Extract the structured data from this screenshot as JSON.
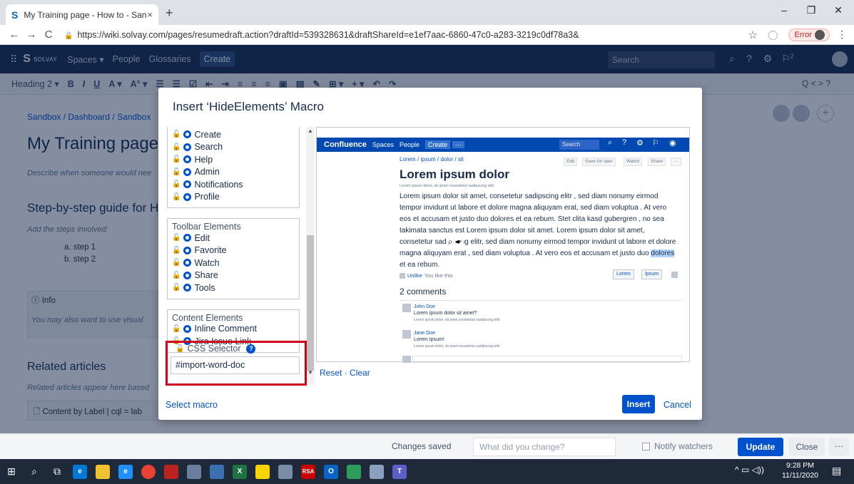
{
  "browser": {
    "tab_title": "My Training page - How to - San",
    "tab_close": "×",
    "new_tab": "+",
    "url": "https://wiki.solvay.com/pages/resumedraft.action?draftId=539328631&draftShareId=e1ef7aac-6860-47c0-a283-3219c0df78a3&",
    "error_label": "Error",
    "win_min": "–",
    "win_max": "❐",
    "win_close": "✕"
  },
  "confluence": {
    "brand": "SOLVAY",
    "menu": [
      "Spaces ▾",
      "People",
      "Glossaries"
    ],
    "create": "Create",
    "search_placeholder": "Search",
    "notif_count": "2"
  },
  "toolbar": {
    "heading": "Heading 2",
    "heading_caret": "▾",
    "buttons": [
      "B",
      "I",
      "U",
      "A ▾",
      "A° ▾",
      "☰",
      "☰",
      "☑",
      "⇤",
      "⇥",
      "≡",
      "≡",
      "≡",
      "▣",
      "▨",
      "✎",
      "⊞ ▾",
      "+ ▾",
      "↶",
      "↷"
    ],
    "right": "Q   < >   ?"
  },
  "page": {
    "breadcrumb": "Sandbox / Dashboard / Sandbox",
    "title": "My Training page",
    "description": "Describe when someone would nee",
    "step_heading": "Step-by-step guide for H",
    "add_steps": "Add the steps involved:",
    "step_a": "a. step 1",
    "step_b": "b. step 2",
    "info_label": "ⓘ  Info",
    "info_text": "You may also want to use visual",
    "related_heading": "Related articles",
    "related_sub": "Related articles appear here based",
    "content_by_label": "Content by Label | cql = lab"
  },
  "footer": {
    "changes_saved": "Changes saved",
    "what_changed_placeholder": "What did you change?",
    "notify": "Notify watchers",
    "update": "Update",
    "close": "Close",
    "more": "···"
  },
  "taskbar": {
    "time": "9:28 PM",
    "date": "11/11/2020"
  },
  "modal": {
    "title": "Insert ‘HideElements’ Macro",
    "header_items": [
      "Create",
      "Search",
      "Help",
      "Admin",
      "Notifications",
      "Profile"
    ],
    "toolbar_legend": "Toolbar Elements",
    "toolbar_items": [
      "Edit",
      "Favorite",
      "Watch",
      "Share",
      "Tools"
    ],
    "content_legend": "Content Elements",
    "content_items": [
      "Inline Comment",
      "Jira Issue Link"
    ],
    "css_selector_label": "CSS Selector",
    "css_selector_value": "#import-word-doc",
    "reset": "Reset",
    "clear": "Clear",
    "reset_sep": "·",
    "select_macro": "Select macro",
    "insert": "Insert",
    "cancel": "Cancel"
  },
  "preview": {
    "brand": "Confluence",
    "spaces": "Spaces",
    "people": "People",
    "create": "Create",
    "search": "Search",
    "crumb": "Lorem / ipsum / dolor / sit",
    "buttons": [
      "Edit",
      "Save for later",
      "Watch",
      "Share",
      "···"
    ],
    "title": "Lorem ipsum dolor",
    "subtitle": "Lorem ipsum dolor, sit amet consetetur sadipscing elitr",
    "body_1": "Lorem ipsum dolor sit amet, consetetur sadipscing elitr , sed diam nonumy eirmod tempor invidunt ut labore et dolore magna aliquyam erat, sed diam voluptua . At vero eos et accusam et justo duo dolores et ea rebum. Stet clita kasd gubergren , no sea takimata sanctus est Lorem ipsum dolor sit amet. Lorem ipsum dolor sit amet, consetetur sadipscing elitr, sed diam nonumy eirmod tempor invidunt ut labore et dolore magna aliquyam erat , sed diam voluptua . At vero eos et accusam et justo duo ",
    "body_highlight": "dolores",
    "body_2": " et ea rebum.",
    "unlike": "Unlike",
    "you_like": "You like this",
    "tags": [
      "Lorem",
      "Ipsum"
    ],
    "comments_heading": "2 comments",
    "comments": [
      {
        "name": "John Doe",
        "text": "Lorem ipsum dolor sit amet?",
        "meta": "Lorem ipsum dolor, sit amet consetetur sadipscing elitr"
      },
      {
        "name": "Jane Doe",
        "text": "Lorem Ipsum!",
        "meta": "Lorem ipsum dolor, sit amet consetetur sadipscing elitr"
      }
    ]
  }
}
